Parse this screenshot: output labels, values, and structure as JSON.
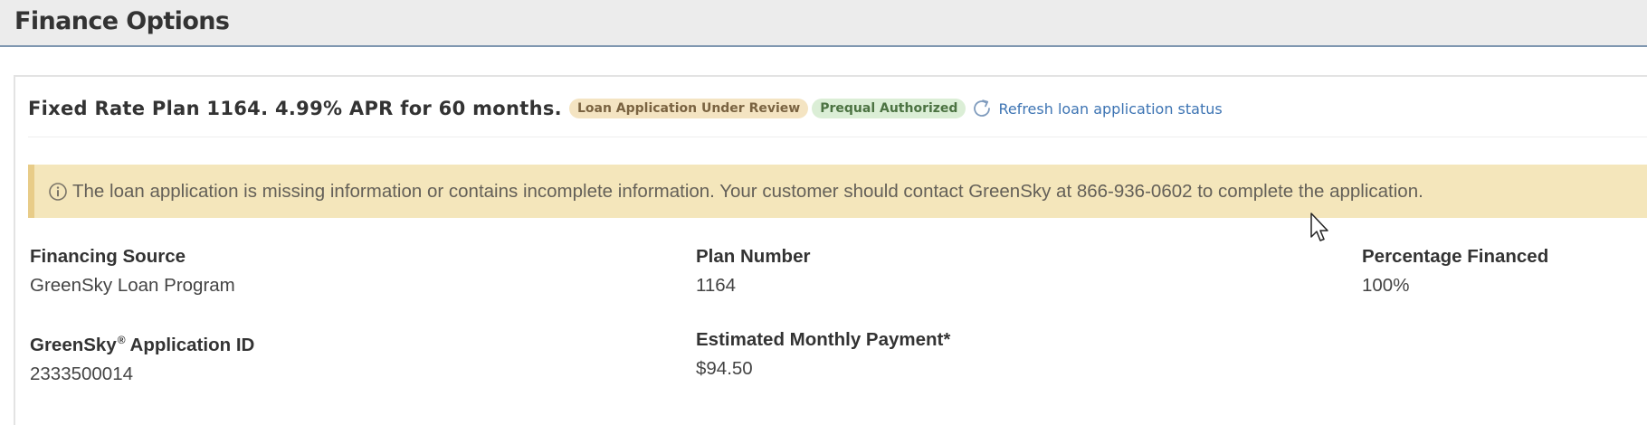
{
  "header": {
    "title": "Finance Options"
  },
  "plan": {
    "title": "Fixed Rate Plan 1164. 4.99% APR for 60 months.",
    "badges": {
      "status": "Loan Application Under Review",
      "prequal": "Prequal Authorized"
    },
    "refresh_label": "Refresh loan application status"
  },
  "alert": {
    "icon": "info-icon",
    "message": "The loan application is missing information or contains incomplete information. Your customer should contact GreenSky at 866-936-0602 to complete the application."
  },
  "fields": {
    "financing_source": {
      "label": "Financing Source",
      "value": "GreenSky Loan Program"
    },
    "plan_number": {
      "label": "Plan Number",
      "value": "1164"
    },
    "percentage_financed": {
      "label": "Percentage Financed",
      "value": "100%"
    },
    "application_id": {
      "label": "GreenSky",
      "label_mark": "®",
      "label_suffix": "Application ID",
      "value": "2333500014"
    },
    "monthly_payment": {
      "label": "Estimated Monthly Payment*",
      "value": "$94.50"
    }
  },
  "colors": {
    "badge_review_bg": "#f4e4c2",
    "badge_prequal_bg": "#dbeed6",
    "alert_bg": "#f4e6bb",
    "link": "#3d74b3"
  }
}
